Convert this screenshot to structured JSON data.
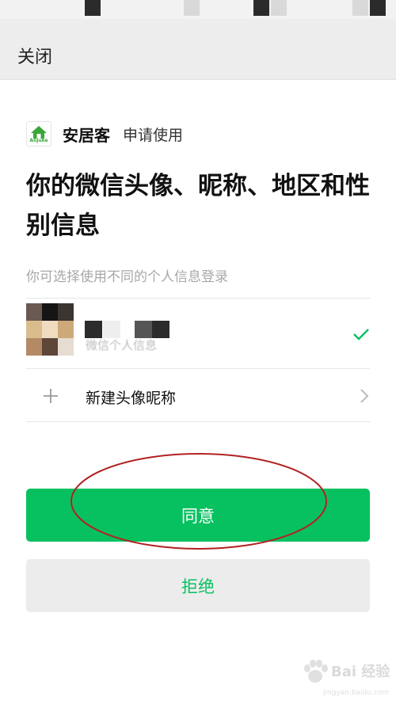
{
  "header": {
    "close_label": "关闭"
  },
  "app": {
    "logo_text": "Anjuke",
    "name": "安居客",
    "apply_text": "申请使用"
  },
  "headline": "你的微信头像、昵称、地区和性别信息",
  "hint": "你可选择使用不同的个人信息登录",
  "profiles": {
    "current_name": "微信个人信息",
    "create_label": "新建头像昵称"
  },
  "buttons": {
    "agree": "同意",
    "reject": "拒绝"
  },
  "watermark": {
    "text": "Bai 经验",
    "url": "jingyan.baidu.com"
  },
  "colors": {
    "accent": "#07c160",
    "annotation": "#b22222"
  },
  "icons": [
    "home-icon",
    "check-icon",
    "plus-icon",
    "chevron-right-icon"
  ]
}
